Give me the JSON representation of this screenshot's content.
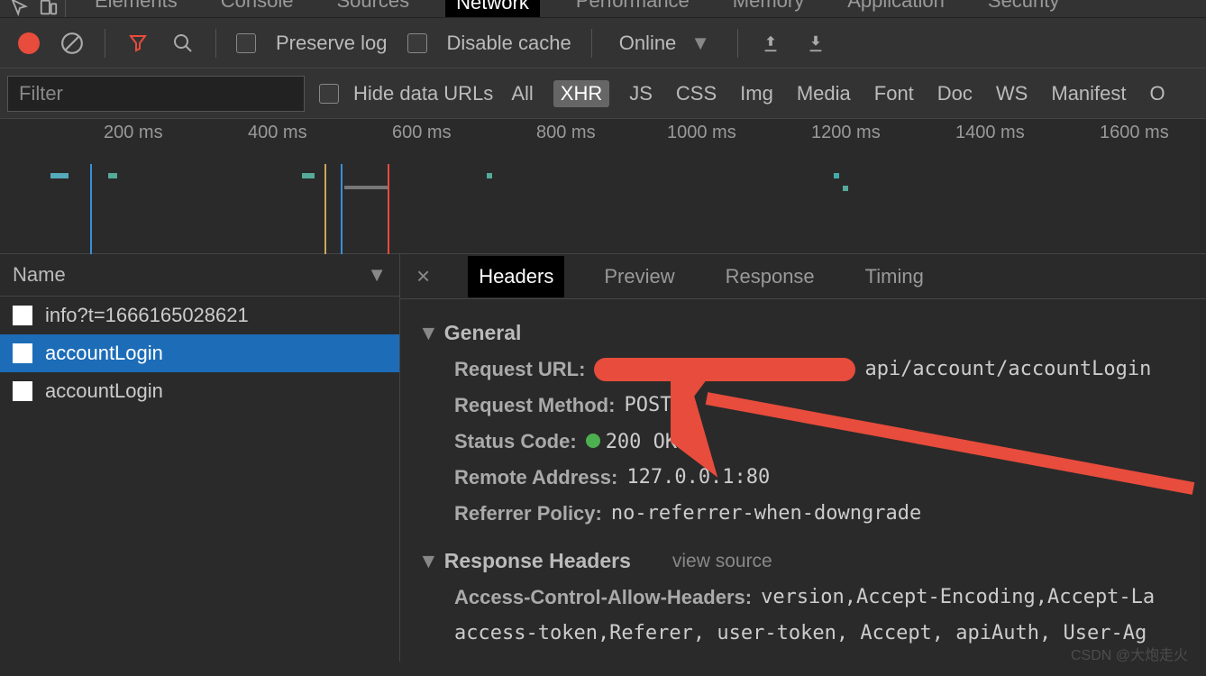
{
  "topTabs": {
    "elements": "Elements",
    "console": "Console",
    "sources": "Sources",
    "network": "Network",
    "performance": "Performance",
    "memory": "Memory",
    "application": "Application",
    "security": "Security"
  },
  "toolbar": {
    "preserve": "Preserve log",
    "disableCache": "Disable cache",
    "throttle": "Online"
  },
  "filter": {
    "placeholder": "Filter",
    "hideDataUrls": "Hide data URLs",
    "types": {
      "all": "All",
      "xhr": "XHR",
      "js": "JS",
      "css": "CSS",
      "img": "Img",
      "media": "Media",
      "font": "Font",
      "doc": "Doc",
      "ws": "WS",
      "manifest": "Manifest",
      "other": "O"
    }
  },
  "timeline": {
    "ticks": [
      "200 ms",
      "400 ms",
      "600 ms",
      "800 ms",
      "1000 ms",
      "1200 ms",
      "1400 ms",
      "1600 ms"
    ]
  },
  "requestList": {
    "header": "Name",
    "rows": [
      {
        "name": "info?t=1666165028621",
        "selected": false
      },
      {
        "name": "accountLogin",
        "selected": true
      },
      {
        "name": "accountLogin",
        "selected": false
      }
    ]
  },
  "detailsTabs": {
    "headers": "Headers",
    "preview": "Preview",
    "response": "Response",
    "timing": "Timing"
  },
  "general": {
    "title": "General",
    "requestUrl": {
      "label": "Request URL:",
      "suffix": "api/account/accountLogin"
    },
    "requestMethod": {
      "label": "Request Method:",
      "value": "POST"
    },
    "statusCode": {
      "label": "Status Code:",
      "value": "200 OK"
    },
    "remoteAddress": {
      "label": "Remote Address:",
      "value": "127.0.0.1:80"
    },
    "referrerPolicy": {
      "label": "Referrer Policy:",
      "value": "no-referrer-when-downgrade"
    }
  },
  "responseHeaders": {
    "title": "Response Headers",
    "viewSource": "view source",
    "acah": {
      "label": "Access-Control-Allow-Headers:",
      "value": "version,Accept-Encoding,Accept-La"
    },
    "line2": "access-token,Referer, user-token, Accept, apiAuth, User-Ag"
  },
  "watermark": "CSDN @大炮走火"
}
